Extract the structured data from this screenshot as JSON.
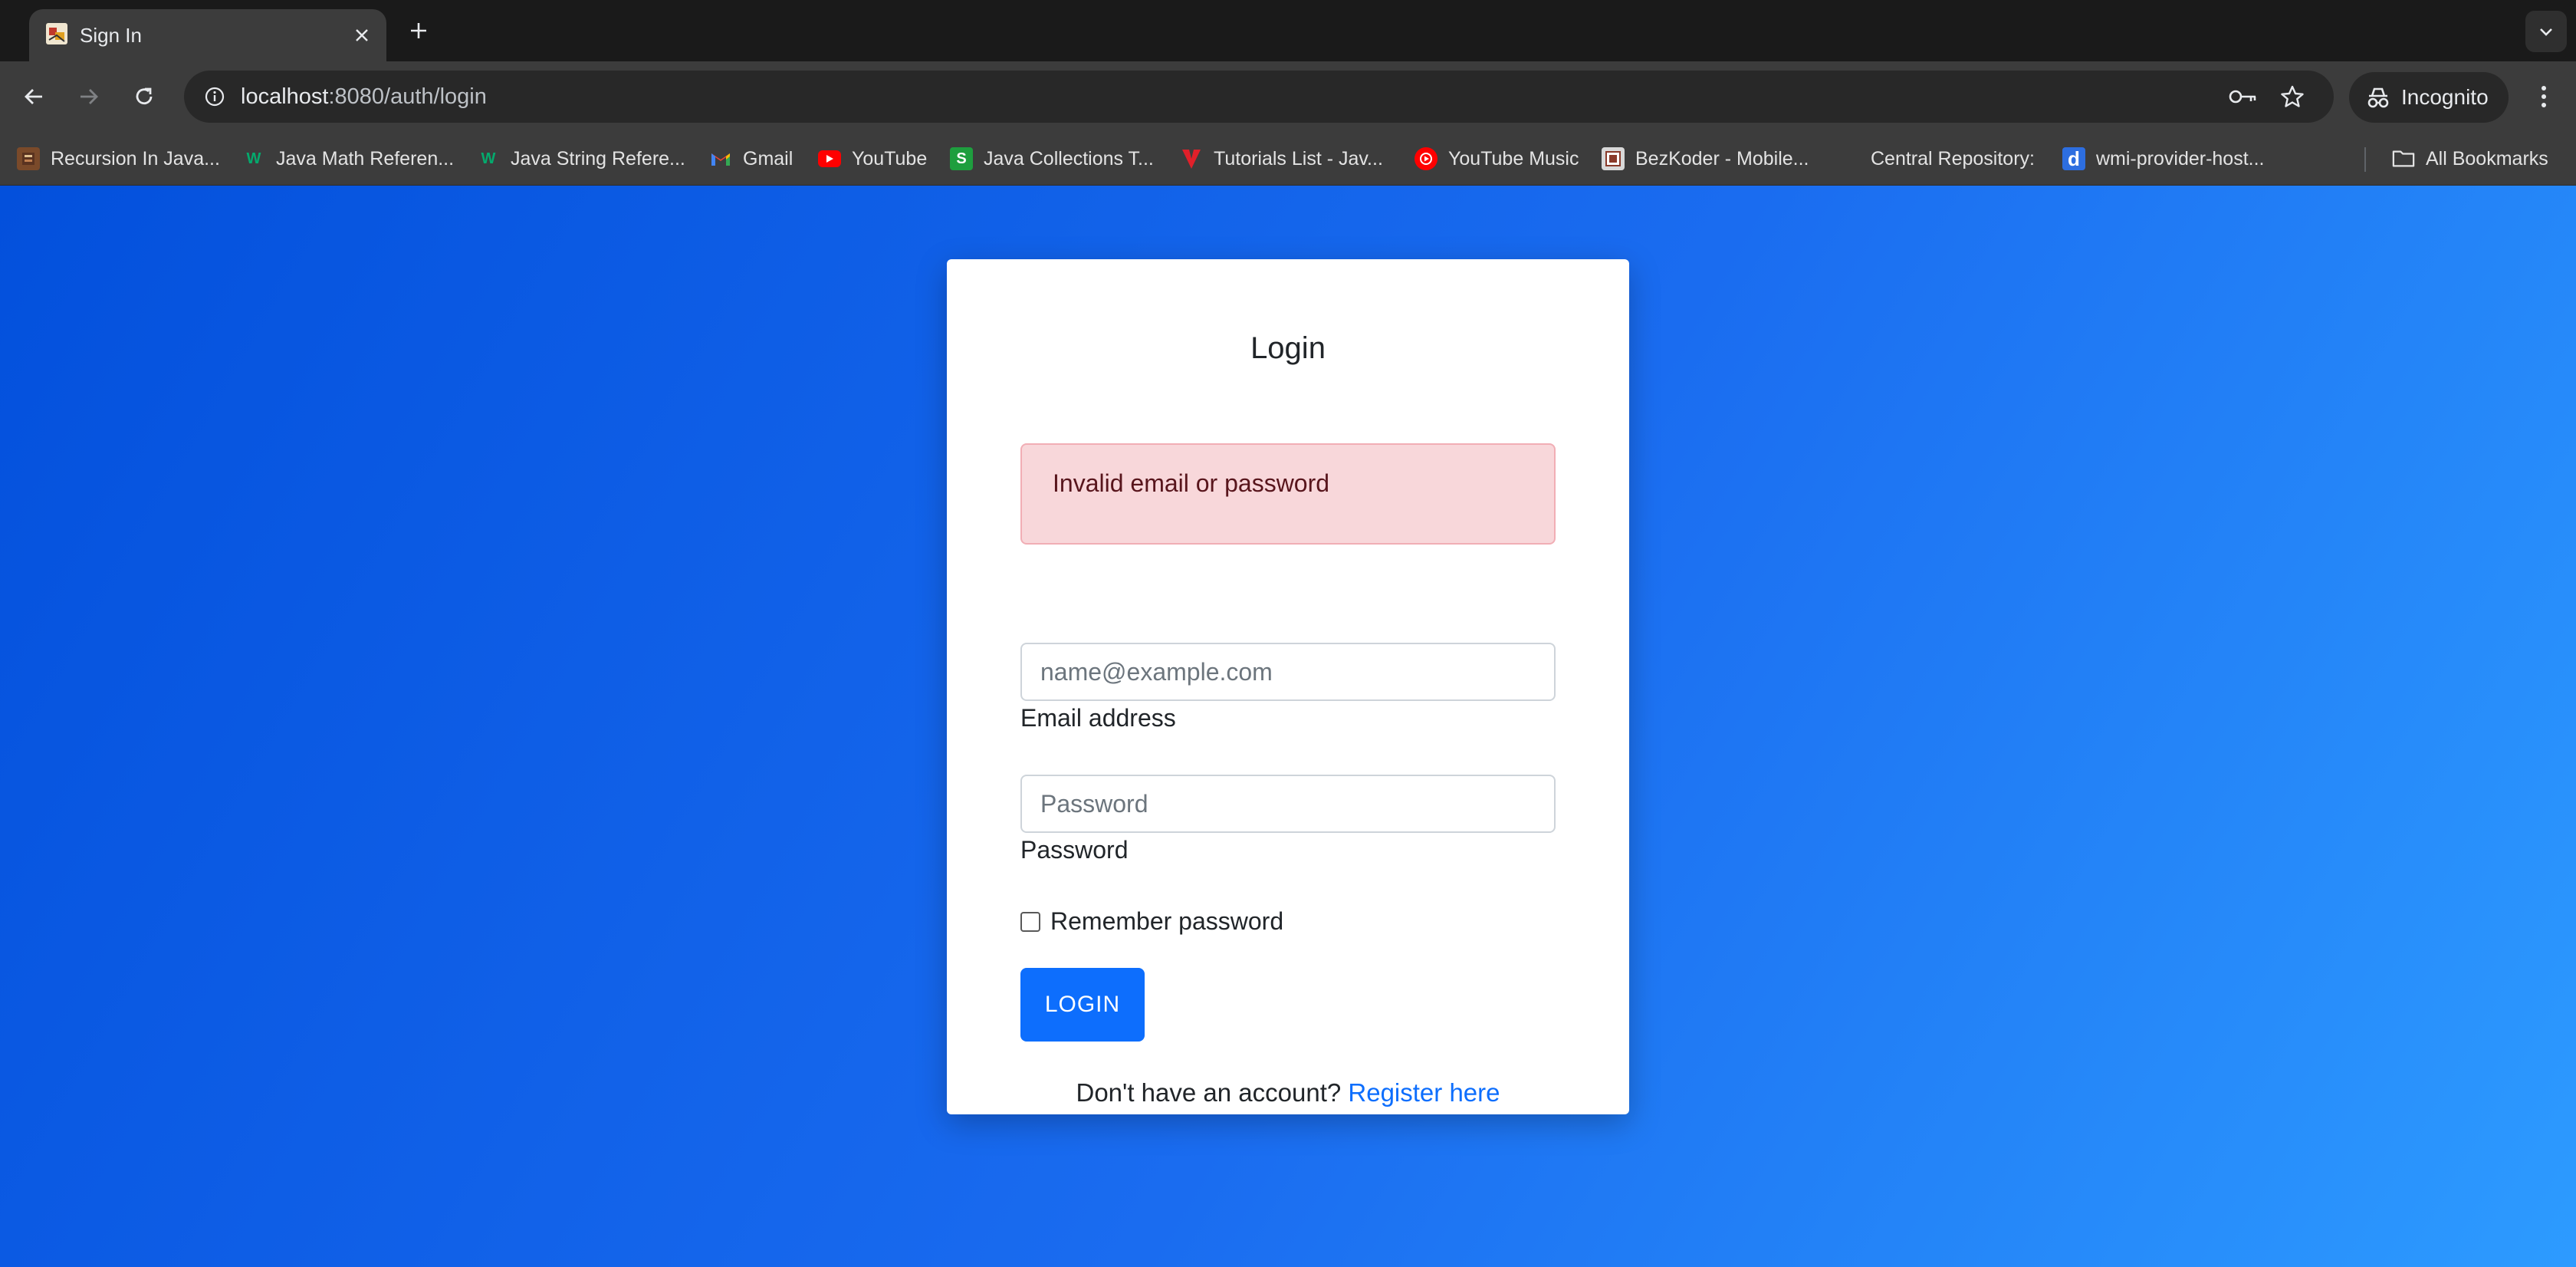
{
  "browser": {
    "tab": {
      "title": "Sign In"
    },
    "url": {
      "host": "localhost",
      "path": ":8080/auth/login"
    },
    "profile_label": "Incognito",
    "bookmarks": [
      {
        "label": "Recursion In Java...",
        "icon": "book-icon",
        "color": "#7a4a2a"
      },
      {
        "label": "Java Math Referen...",
        "icon": "w3schools-icon",
        "color": "#04aa6d"
      },
      {
        "label": "Java String Refere...",
        "icon": "w3schools-icon",
        "color": "#04aa6d"
      },
      {
        "label": "Gmail",
        "icon": "gmail-icon",
        "color": "#ea4335"
      },
      {
        "label": "YouTube",
        "icon": "youtube-icon",
        "color": "#ff0000"
      },
      {
        "label": "Java Collections T...",
        "icon": "s-icon",
        "color": "#1e9e3e"
      },
      {
        "label": "Tutorials List - Jav...",
        "icon": "v-icon",
        "color": "#e0202a"
      },
      {
        "label": "YouTube Music",
        "icon": "youtube-music-icon",
        "color": "#ff0000"
      },
      {
        "label": "BezKoder - Mobile...",
        "icon": "bezkoder-icon",
        "color": "#d8d8d8"
      },
      {
        "label": "Central Repository:",
        "icon": "",
        "color": ""
      },
      {
        "label": "wmi-provider-host...",
        "icon": "d-icon",
        "color": "#2d6ee0"
      }
    ],
    "all_bookmarks_label": "All Bookmarks"
  },
  "login": {
    "title": "Login",
    "error": "Invalid email or password",
    "email": {
      "placeholder": "name@example.com",
      "label": "Email address",
      "value": ""
    },
    "password": {
      "placeholder": "Password",
      "label": "Password",
      "value": ""
    },
    "remember_label": "Remember password",
    "submit_label": "LOGIN",
    "register_prompt": "Don't have an account?",
    "register_link": "Register here"
  },
  "colors": {
    "primary": "#0d6efd",
    "alert_bg": "#f8d7da",
    "alert_text": "#58151c",
    "page_gradient_start": "#0350dc",
    "page_gradient_end": "#2d9bff"
  }
}
